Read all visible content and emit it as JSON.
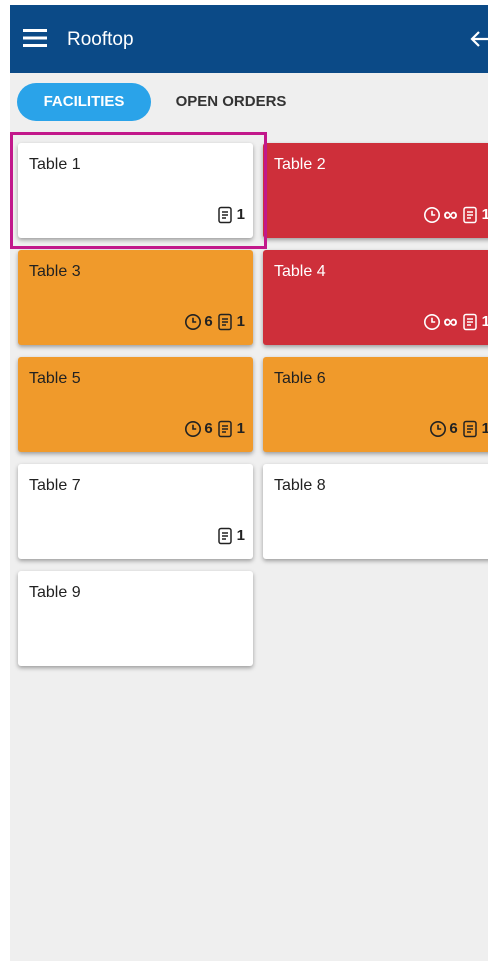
{
  "appbar": {
    "title": "Rooftop"
  },
  "tabs": [
    {
      "label": "FACILITIES"
    },
    {
      "label": "OPEN ORDERS"
    }
  ],
  "tables": [
    {
      "name": "Table 1",
      "status": "white",
      "timer": "",
      "orders": "1"
    },
    {
      "name": "Table 2",
      "status": "red",
      "timer": "∞",
      "orders": "1"
    },
    {
      "name": "Table 3",
      "status": "orange",
      "timer": "6",
      "orders": "1"
    },
    {
      "name": "Table 4",
      "status": "red",
      "timer": "∞",
      "orders": "1"
    },
    {
      "name": "Table 5",
      "status": "orange",
      "timer": "6",
      "orders": "1"
    },
    {
      "name": "Table 6",
      "status": "orange",
      "timer": "6",
      "orders": "1"
    },
    {
      "name": "Table 7",
      "status": "white",
      "timer": "",
      "orders": "1"
    },
    {
      "name": "Table 8",
      "status": "white",
      "timer": "",
      "orders": ""
    },
    {
      "name": "Table 9",
      "status": "white",
      "timer": "",
      "orders": ""
    }
  ],
  "colors": {
    "appbar": "#0b4a87",
    "tab_active": "#2aa3e9",
    "orange": "#f09a2b",
    "red": "#ce2f3a",
    "highlight": "#c2188b"
  },
  "icons": [
    "menu-icon",
    "back-arrow-icon",
    "clock-icon",
    "receipt-icon"
  ]
}
